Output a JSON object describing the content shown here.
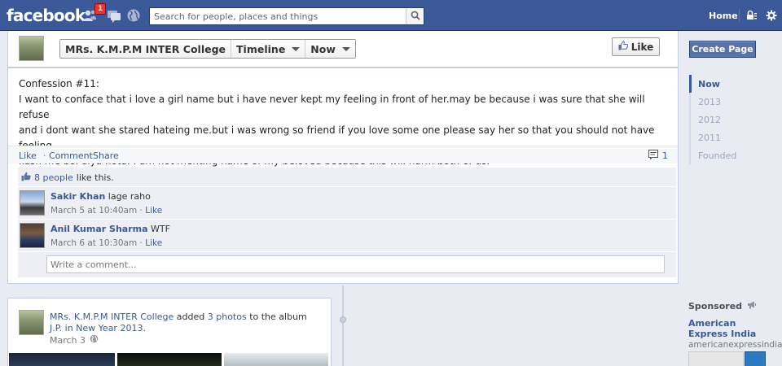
{
  "topbar": {
    "logo": "facebook",
    "friend_requests_badge": "1",
    "search_placeholder": "Search for people, places and things",
    "home_label": "Home"
  },
  "page_header": {
    "page_name": "MRs. K.M.P.M INTER College",
    "timeline_label": "Timeline",
    "period_label": "Now",
    "like_button_label": "Like"
  },
  "post": {
    "title": "Confession #11:",
    "body": "I want to conface that i love a girl name but i have never kept my feeling in front of her.may be because i was sure that she will refuse\nand i dont want she stared hateing me.but i was wrong so friend if you love some one please say her so that you should not have feeling\nkash me bol diya hota. I am not menting name of my beloved because this will harm both of us.",
    "actions": {
      "like": "Like",
      "comment": "Comment",
      "share": "Share",
      "separator": "·"
    },
    "comment_count": "1",
    "likes_link": "8 people",
    "likes_suffix": "like this.",
    "comments": [
      {
        "author": "Sakir Khan",
        "text": "lage raho",
        "time": "March 5 at 10:40am",
        "like": "Like"
      },
      {
        "author": "Anil Kumar Sharma",
        "text": "WTF",
        "time": "March 6 at 10:30am",
        "like": "Like"
      }
    ],
    "write_comment_placeholder": "Write a comment..."
  },
  "story": {
    "page_link": "MRs. K.M.P.M INTER College",
    "verb": "added",
    "photos_link": "3 photos",
    "to_album": "to the album",
    "album_link": "J.P. in New Year 2013.",
    "date": "March 3"
  },
  "sidebar": {
    "create_page_label": "Create Page",
    "years": [
      {
        "label": "Now",
        "active": true
      },
      {
        "label": "2013",
        "active": false
      },
      {
        "label": "2012",
        "active": false
      },
      {
        "label": "2011",
        "active": false
      },
      {
        "label": "Founded",
        "active": false
      }
    ],
    "sponsored_label": "Sponsored",
    "ad_title": "American Express India",
    "ad_url": "americanexpressindia...."
  },
  "colors": {
    "brand": "#3b5998",
    "topbar_border": "#133783",
    "badge": "#e33333"
  }
}
